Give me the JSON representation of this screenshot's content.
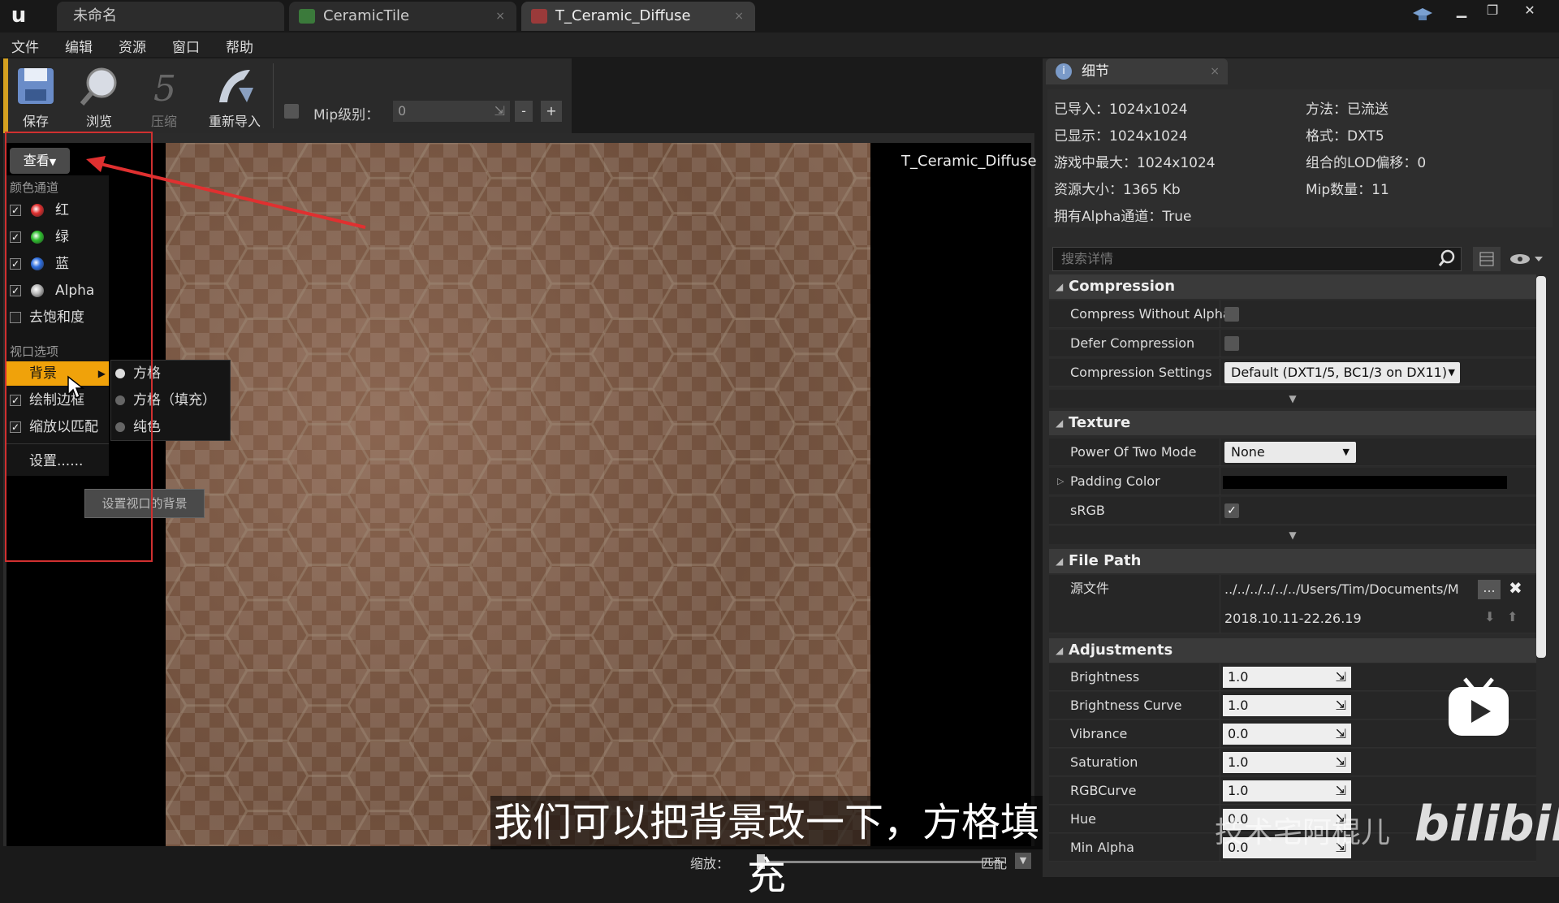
{
  "window": {
    "tabs": [
      {
        "label": "未命名"
      },
      {
        "label": "CeramicTile"
      },
      {
        "label": "T_Ceramic_Diffuse"
      }
    ]
  },
  "menu": [
    "文件",
    "编辑",
    "资源",
    "窗口",
    "帮助"
  ],
  "toolbar": {
    "save": "保存",
    "browse": "浏览",
    "compress": "压缩",
    "reimport": "重新导入",
    "mip_label": "Mip级别：",
    "mip_value": "0",
    "minus": "-",
    "plus": "+"
  },
  "view_menu": {
    "button": "查看",
    "color_channels_header": "颜色通道",
    "channels": [
      {
        "label": "红",
        "checked": true,
        "color": "#e03030"
      },
      {
        "label": "绿",
        "checked": true,
        "color": "#30c030"
      },
      {
        "label": "蓝",
        "checked": true,
        "color": "#3070e0"
      },
      {
        "label": "Alpha",
        "checked": true,
        "color": "#bbbbbb"
      }
    ],
    "desaturate": "去饱和度",
    "viewport_header": "视口选项",
    "background": "背景",
    "draw_border": "绘制边框",
    "scale_to_fit": "缩放以匹配",
    "settings": "设置......",
    "submenu": [
      "方格",
      "方格（填充）",
      "纯色"
    ],
    "tooltip": "设置视口的背景"
  },
  "viewport": {
    "texture_name": "T_Ceramic_Diffuse",
    "zoom_label": "缩放：",
    "zoom_mode": "匹配"
  },
  "details": {
    "tab": "细节",
    "info_left": [
      "已导入：1024x1024",
      "已显示：1024x1024",
      "游戏中最大：1024x1024",
      "资源大小：1365 Kb",
      "拥有Alpha通道：True"
    ],
    "info_right": [
      "方法：已流送",
      "格式：DXT5",
      "组合的LOD偏移：0",
      "Mip数量：11"
    ],
    "search_placeholder": "搜索详情",
    "compression": {
      "title": "Compression",
      "compress_without_alpha": "Compress Without Alpha",
      "defer_compression": "Defer Compression",
      "compression_settings": "Compression Settings",
      "compression_settings_value": "Default (DXT1/5, BC1/3 on DX11)"
    },
    "texture": {
      "title": "Texture",
      "power_of_two": "Power Of Two Mode",
      "power_of_two_value": "None",
      "padding_color": "Padding Color",
      "srgb": "sRGB"
    },
    "file_path": {
      "title": "File Path",
      "source_label": "源文件",
      "source_value": "../../../../../../Users/Tim/Documents/M",
      "browse": "...",
      "timestamp": "2018.10.11-22.26.19"
    },
    "adjustments": {
      "title": "Adjustments",
      "rows": [
        {
          "label": "Brightness",
          "value": "1.0"
        },
        {
          "label": "Brightness Curve",
          "value": "1.0"
        },
        {
          "label": "Vibrance",
          "value": "0.0"
        },
        {
          "label": "Saturation",
          "value": "1.0"
        },
        {
          "label": "RGBCurve",
          "value": "1.0"
        },
        {
          "label": "Hue",
          "value": "0.0"
        },
        {
          "label": "Min Alpha",
          "value": "0.0"
        }
      ]
    }
  },
  "overlay": {
    "subtitle": "我们可以把背景改一下，方格填充",
    "watermark_name": "技术宅阿棍儿",
    "watermark_logo": "bilibili"
  }
}
